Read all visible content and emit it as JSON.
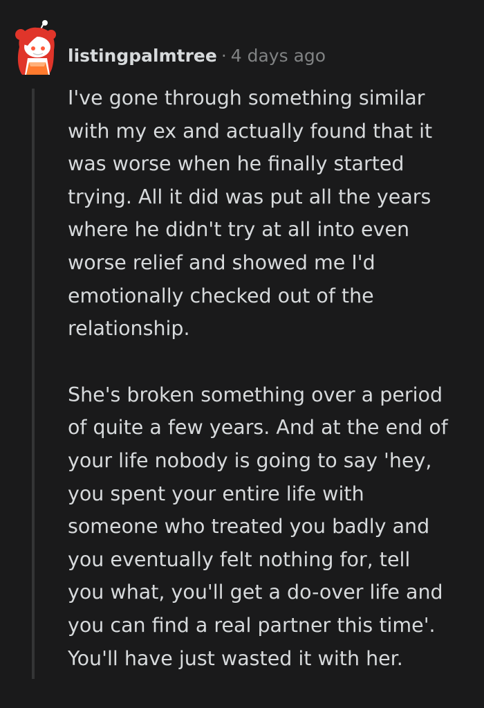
{
  "comment": {
    "username": "listingpalmtree",
    "separator": "·",
    "timestamp": "4 days ago",
    "avatar_icon": "reddit-snoo-avatar-icon",
    "paragraphs": [
      "I've gone through something similar\nwith my ex and actually found that it\nwas worse when he finally started\ntrying. All it did was put all the years\nwhere he didn't try at all into even\nworse relief and showed me I'd\nemotionally checked out of the\nrelationship.",
      "She's broken something over a period\nof quite a few years. And at the end of\nyour life nobody is going to say 'hey,\nyou spent your entire life with\nsomeone who treated you badly and\nyou eventually felt nothing for, tell\nyou what, you'll get a do-over life and\nyou can find a real partner this time'.\nYou'll have just wasted it with her."
    ]
  },
  "colors": {
    "background": "#1a1a1b",
    "text": "#d7dadc",
    "meta": "#818384",
    "thread_line": "#343536",
    "avatar_red": "#e0352a"
  }
}
